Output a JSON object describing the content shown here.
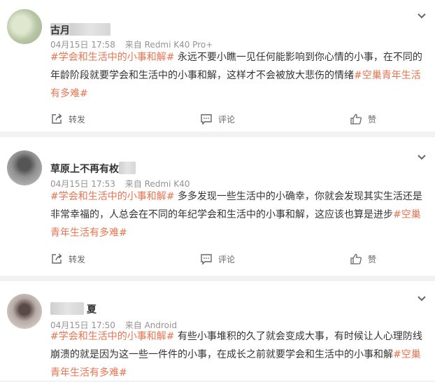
{
  "posts": [
    {
      "nickname": "古月",
      "date": "04月15日 17:58",
      "source": "来自 Redmi K40 Pro+",
      "hashtag1": "#学会和生活中的小事和解#",
      "body": " 永远不要小瞧一见任何能影响到你心情的小事，在不同的年龄阶段就要学会和生活中的小事和解，这样才不会被放大悲伤的情绪",
      "hashtag2": "#空巢青年生活有多难#"
    },
    {
      "nickname": "草原上不再有枚",
      "date": "04月15日 17:53",
      "source": "来自 Redmi K40",
      "hashtag1": "#学会和生活中的小事和解#",
      "body": " 多多发现一些生活中的小确幸，你就会发现其实生活还是非常幸福的，人总会在不同的年纪学会和生活中的小事和解，这应该也算是进步",
      "hashtag2": "#空巢青年生活有多难#"
    },
    {
      "nickname": "夏",
      "date": "04月15日 17:50",
      "source": "来自 Android",
      "hashtag1": "#学会和生活中的小事和解#",
      "body": " 有些小事堆积的久了就会变成大事，有时候让人心理防线崩溃的就是因为这一些一件件的小事，在成长之前就要学会和生活中的小事和解",
      "hashtag2": "#空巢青年生活有多难#"
    }
  ],
  "actions": {
    "share": "转发",
    "comment": "评论",
    "like": "赞"
  },
  "icons": {
    "share": "share-icon",
    "comment": "comment-icon",
    "like": "thumbs-up-icon",
    "menu": "chevron-down-icon"
  },
  "colors": {
    "hashtag": "#eb7350",
    "meta": "#939393",
    "background": "#f2f2f2"
  }
}
